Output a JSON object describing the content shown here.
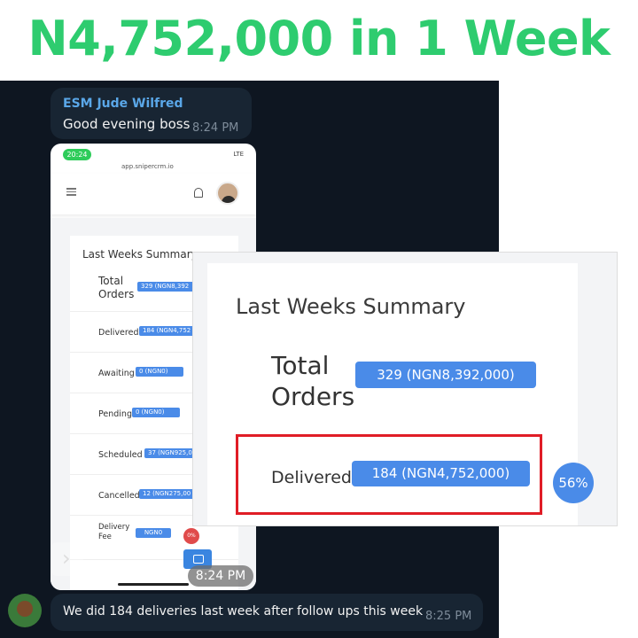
{
  "headline": "N4,752,000 in 1 Week",
  "chat": {
    "message1": {
      "sender": "ESM Jude Wilfred",
      "text": "Good evening boss",
      "time": "8:24 PM"
    },
    "image_time": "8:24 PM",
    "message2": {
      "text": "We did 184 deliveries last week after follow ups this week",
      "time": "8:25 PM"
    }
  },
  "phone": {
    "status_time": "20:24",
    "status_right": "LTE",
    "url": "app.snipercrm.io",
    "card_title": "Last Weeks Summary",
    "rows": [
      {
        "label": "Total Orders",
        "value": "329 (NGN8,392"
      },
      {
        "label": "Delivered",
        "value": "184 (NGN4,752"
      },
      {
        "label": "Awaiting",
        "value": "0 (NGN0)"
      },
      {
        "label": "Pending",
        "value": "0 (NGN0)"
      },
      {
        "label": "Scheduled",
        "value": "37 (NGN925,0"
      },
      {
        "label": "Cancelled",
        "value": "12 (NGN275,00"
      },
      {
        "label": "Delivery Fee",
        "value": "NGN0"
      }
    ],
    "fab_red": "0%"
  },
  "zoom": {
    "title": "Last Weeks Summary",
    "total_label": "Total Orders",
    "total_value": "329 (NGN8,392,000)",
    "delivered_label": "Delivered",
    "delivered_value": "184 (NGN4,752,000)",
    "delivered_pct": "56%"
  }
}
